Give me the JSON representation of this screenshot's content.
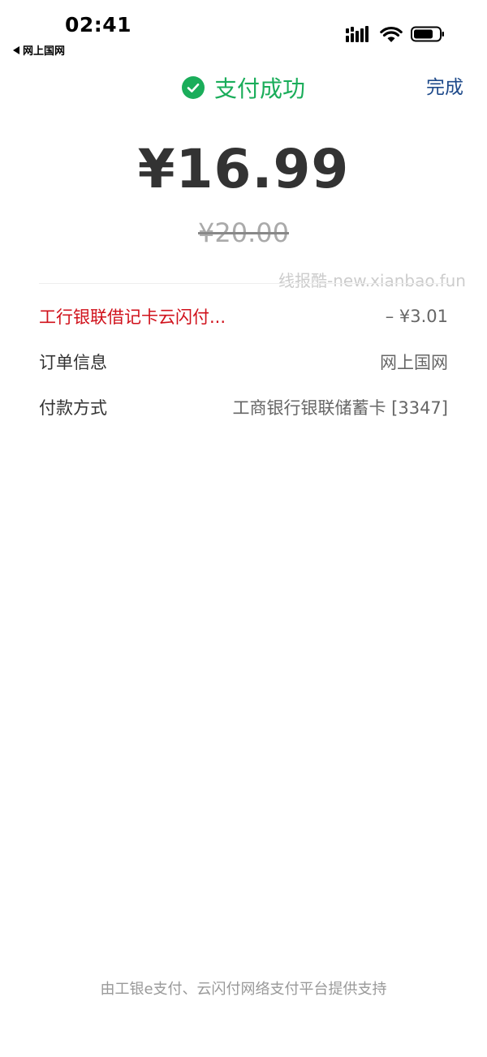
{
  "status_bar": {
    "time": "02:41",
    "back_app": "网上国网"
  },
  "header": {
    "title": "支付成功",
    "done_label": "完成"
  },
  "payment": {
    "amount": "¥16.99",
    "original_amount": "¥20.00"
  },
  "watermark": "线报酷-new.xianbao.fun",
  "rows": {
    "discount": {
      "label": "工行银联借记卡云闪付...",
      "value": "– ¥3.01"
    },
    "order": {
      "label": "订单信息",
      "value": "网上国网"
    },
    "payment_method": {
      "label": "付款方式",
      "value": "工商银行银联储蓄卡 [3347]"
    }
  },
  "footer": "由工银e支付、云闪付网络支付平台提供支持",
  "colors": {
    "success_green": "#1aad5a",
    "discount_red": "#d0111b",
    "done_blue": "#1e4a8a"
  },
  "icons": [
    "back-triangle-icon",
    "signal-icon",
    "wifi-icon",
    "battery-icon",
    "check-circle-icon"
  ]
}
